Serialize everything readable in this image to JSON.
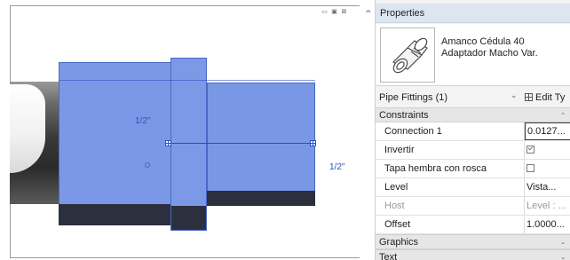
{
  "viewport": {
    "controls": [
      "▭",
      "▣",
      "⊠"
    ],
    "dimension_labels": [
      "1/2\"",
      "1/2\""
    ]
  },
  "panel": {
    "collapse_caret": "^",
    "title": "Properties",
    "type_name": "Amanco Cédula 40 Adaptador Macho Var.",
    "selector_text": "Pipe Fittings (1)",
    "selector_arrow": "⌄",
    "edit_type_label": "Edit Ty"
  },
  "sections": {
    "constraints": "Constraints",
    "graphics": "Graphics",
    "text": "Text"
  },
  "properties": [
    {
      "name": "Connection 1",
      "value": "0.0127..."
    },
    {
      "name": "Invertir",
      "checkbox": true,
      "checked": true
    },
    {
      "name": "Tapa hembra con rosca",
      "checkbox": true,
      "checked": false
    },
    {
      "name": "Level",
      "value": "Vista..."
    },
    {
      "name": "Host",
      "value": "Level : ..."
    },
    {
      "name": "Offset",
      "value": "1.0000..."
    }
  ]
}
